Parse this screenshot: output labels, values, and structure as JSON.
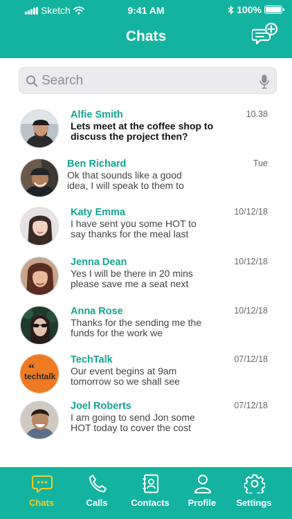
{
  "status_bar": {
    "carrier": "Sketch",
    "time": "9:41 AM",
    "battery": "100%"
  },
  "header": {
    "title": "Chats"
  },
  "search": {
    "placeholder": "Search"
  },
  "chats": [
    {
      "name": "Alfie Smith",
      "time": "10.38",
      "message": "Lets meet at the coffee shop to discuss the project then?",
      "unread": true
    },
    {
      "name": "Ben Richard",
      "time": "Tue",
      "message": "Ok that sounds like a good idea, I will speak to them to",
      "unread": false
    },
    {
      "name": "Katy Emma",
      "time": "10/12/18",
      "message": "I have sent you some HOT to say thanks for the meal last",
      "unread": false
    },
    {
      "name": "Jenna Dean",
      "time": "10/12/18",
      "message": "Yes I will be there in 20 mins please save me a seat next",
      "unread": false
    },
    {
      "name": "Anna Rose",
      "time": "10/12/18",
      "message": "Thanks for the sending me the funds for the work we",
      "unread": false
    },
    {
      "name": "TechTalk",
      "time": "07/12/18",
      "message": "Our event begins at 9am tomorrow so we shall see",
      "unread": false,
      "logo_text": "techtalk"
    },
    {
      "name": "Joel Roberts",
      "time": "07/12/18",
      "message": "I am going to send Jon some HOT today to cover the cost",
      "unread": false
    }
  ],
  "tabs": [
    {
      "label": "Chats",
      "icon": "chat-bubble-icon",
      "active": true
    },
    {
      "label": "Calls",
      "icon": "phone-icon",
      "active": false
    },
    {
      "label": "Contacts",
      "icon": "contacts-book-icon",
      "active": false
    },
    {
      "label": "Profile",
      "icon": "person-icon",
      "active": false
    },
    {
      "label": "Settings",
      "icon": "gear-icon",
      "active": false
    }
  ],
  "colors": {
    "primary": "#13b39f",
    "name_text": "#13a393",
    "active_tab": "#f5cb1d",
    "techtalk_orange": "#ee7a23"
  }
}
